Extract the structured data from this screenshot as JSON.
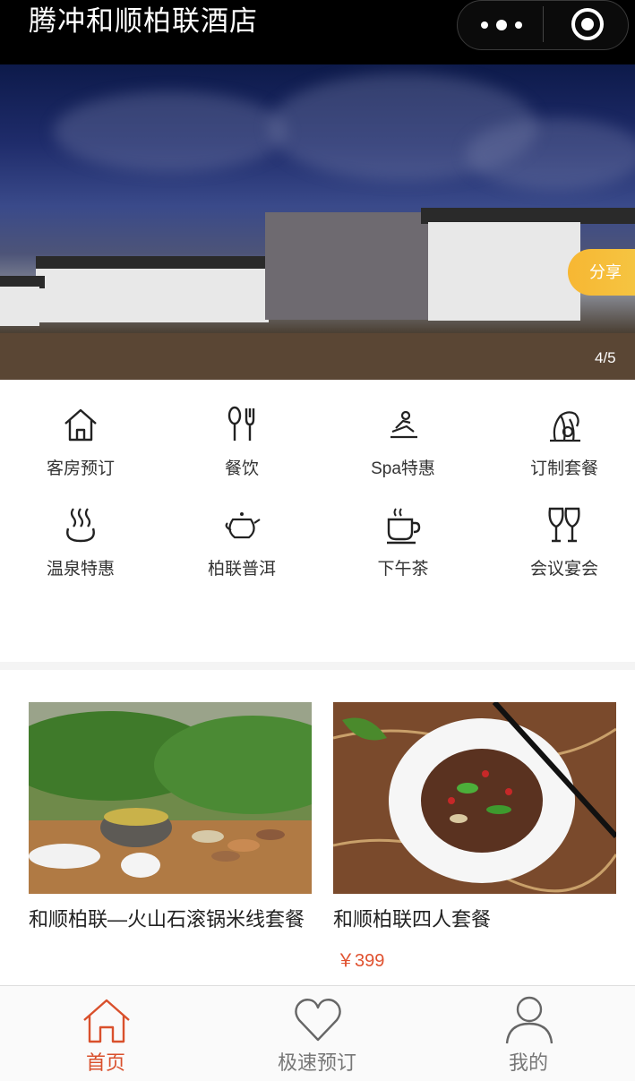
{
  "header": {
    "title": "腾冲和顺柏联酒店"
  },
  "banner": {
    "share_label": "分享",
    "indicator": "4/5"
  },
  "menu": {
    "items": [
      {
        "label": "客房预订",
        "icon": "house-icon"
      },
      {
        "label": "餐饮",
        "icon": "spoon-fork-icon"
      },
      {
        "label": "Spa特惠",
        "icon": "spa-massage-icon"
      },
      {
        "label": "订制套餐",
        "icon": "palm-tree-icon"
      },
      {
        "label": "温泉特惠",
        "icon": "hot-spring-icon"
      },
      {
        "label": "柏联普洱",
        "icon": "teapot-icon"
      },
      {
        "label": "下午茶",
        "icon": "coffee-cup-icon"
      },
      {
        "label": "会议宴会",
        "icon": "wine-glasses-icon"
      }
    ]
  },
  "products": [
    {
      "name": "和顺柏联—火山石滚锅米线套餐",
      "price": ""
    },
    {
      "name": "和顺柏联四人套餐",
      "price": "￥399"
    }
  ],
  "tabbar": {
    "tabs": [
      {
        "label": "首页",
        "icon": "home-icon",
        "color": "#d9502c",
        "active": true
      },
      {
        "label": "极速预订",
        "icon": "heart-icon",
        "color": "#777777",
        "active": false
      },
      {
        "label": "我的",
        "icon": "user-icon",
        "color": "#777777",
        "active": false
      }
    ]
  },
  "colors": {
    "accent": "#d9502c",
    "price": "#e0512f",
    "share": "#f5c542"
  }
}
